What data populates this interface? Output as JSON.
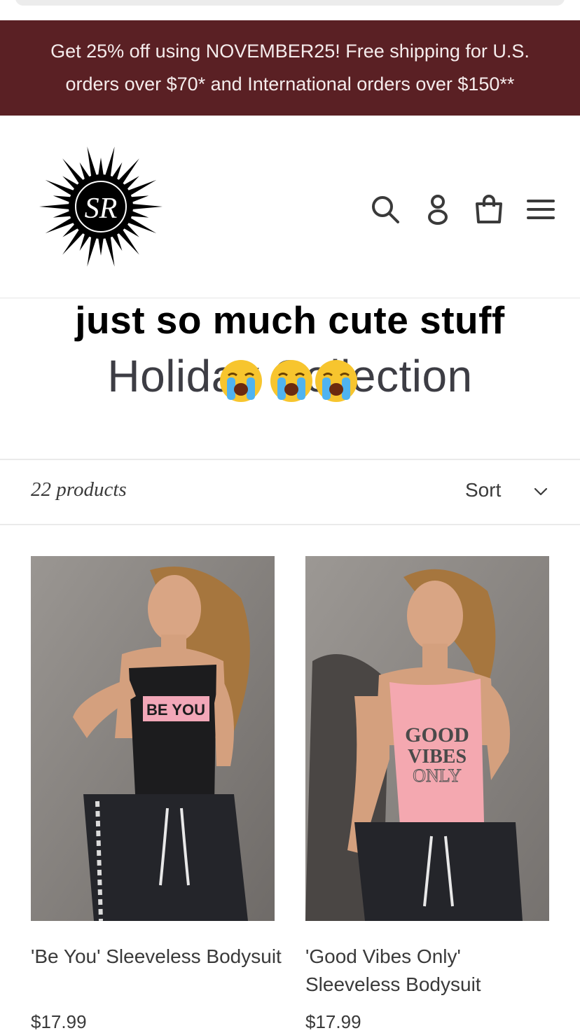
{
  "announcement": {
    "text": "Get 25% off using NOVEMBER25! Free shipping for U.S. orders over $70* and International orders over $150**"
  },
  "header": {
    "logo_text": "SR",
    "icons": [
      "search-icon",
      "account-icon",
      "cart-icon",
      "menu-icon"
    ]
  },
  "story_overlay": {
    "caption": "just so much cute stuff",
    "emoji": [
      "loudly-crying-face",
      "loudly-crying-face",
      "loudly-crying-face"
    ]
  },
  "collection": {
    "title": "Holiday Collection",
    "product_count": "22 products",
    "sort_label": "Sort"
  },
  "products": [
    {
      "title": "'Be You' Sleeveless Bodysuit",
      "price": "$17.99",
      "print_text": "BE YOU",
      "colors": {
        "bodysuit": "#1c1c1e",
        "print": "#f2a7b8"
      }
    },
    {
      "title": "'Good Vibes Only' Sleeveless Bodysuit",
      "price": "$17.99",
      "print_text": "GOOD VIBES ONLY",
      "colors": {
        "bodysuit": "#f4a8b0",
        "print": "#4a4a4a"
      }
    }
  ],
  "colors": {
    "announcement_bg": "#5a2024",
    "announcement_text": "#f5ecec",
    "text": "#3a3a3a"
  }
}
